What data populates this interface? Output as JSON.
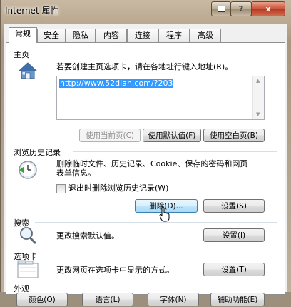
{
  "window": {
    "title": "Internet 属性",
    "help_label": "?",
    "close_label": "x"
  },
  "tabs": [
    {
      "label": "常规",
      "active": true
    },
    {
      "label": "安全"
    },
    {
      "label": "隐私"
    },
    {
      "label": "内容"
    },
    {
      "label": "连接"
    },
    {
      "label": "程序"
    },
    {
      "label": "高级"
    }
  ],
  "homepage": {
    "group_title": "主页",
    "description": "若要创建主页选项卡，请在各地址行键入地址(R)。",
    "url": "http://www.52dian.com/?203",
    "use_current_label": "使用当前页(C)",
    "use_default_label": "使用默认值(F)",
    "use_blank_label": "使用空白页(B)"
  },
  "history": {
    "group_title": "浏览历史记录",
    "description_line1": "删除临时文件、历史记录、Cookie、保存的密码和网页",
    "description_line2": "表单信息。",
    "checkbox_label": "退出时删除浏览历史记录(W)",
    "checkbox_checked": false,
    "delete_label": "删除(D)...",
    "settings_label": "设置(S)"
  },
  "search": {
    "group_title": "搜索",
    "description": "更改搜索默认值。",
    "settings_label": "设置(I)"
  },
  "tabs_section": {
    "group_title": "选项卡",
    "description": "更改网页在选项卡中显示的方式。",
    "settings_label": "设置(T)"
  },
  "appearance": {
    "group_title": "外观",
    "colors_label": "颜色(O)",
    "languages_label": "语言(L)",
    "fonts_label": "字体(N)",
    "accessibility_label": "辅助功能(E)"
  }
}
